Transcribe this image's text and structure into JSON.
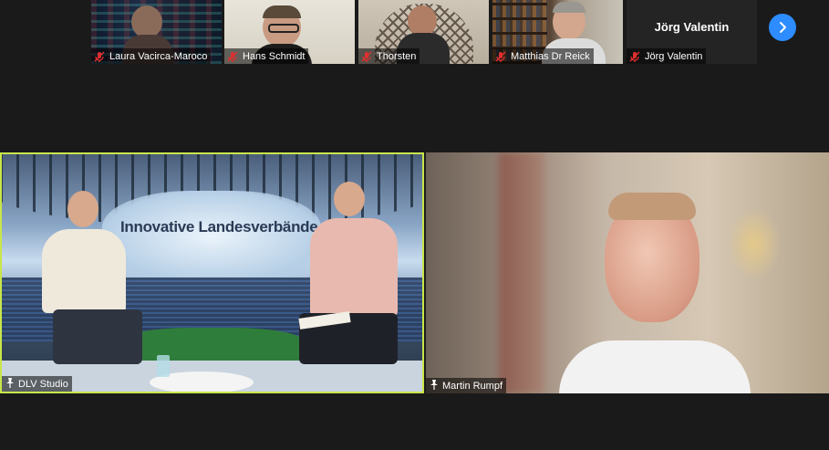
{
  "thumbnails": [
    {
      "name": "Laura Vacirca-Maroco",
      "muted": true
    },
    {
      "name": "Hans Schmidt",
      "muted": true
    },
    {
      "name": "Thorsten",
      "muted": true
    },
    {
      "name": "Matthias Dr Reick",
      "muted": true
    },
    {
      "name": "Jörg Valentin",
      "muted": true
    }
  ],
  "name_card": {
    "title": "Jörg Valentin"
  },
  "next_page": {
    "icon": "chevron-right-icon"
  },
  "main_tiles": [
    {
      "name": "DLV Studio",
      "active_speaker": true,
      "banner": "Innovative Landesverbände"
    },
    {
      "name": "Martin Rumpf",
      "active_speaker": false
    }
  ],
  "colors": {
    "accent": "#2d8cff",
    "active_border": "#c8e64a",
    "muted": "#e02f2f"
  }
}
